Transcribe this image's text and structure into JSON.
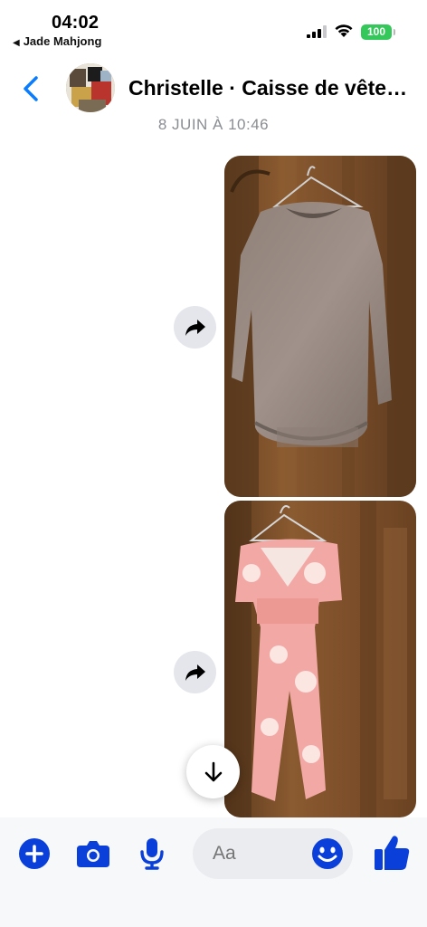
{
  "status_bar": {
    "time": "04:02",
    "back_app": "Jade Mahjong",
    "battery": "100",
    "battery_color": "#34c759"
  },
  "header": {
    "title": "Christelle · Caisse de vêtements",
    "back_icon": "chevron-left-icon",
    "accent_color": "#0a7cff"
  },
  "thread": {
    "date_separator": "8 JUIN À 10:46",
    "messages": [
      {
        "type": "photo",
        "subject": "taupe-sweater-dress",
        "share_icon": "share-arrow-icon"
      },
      {
        "type": "photo",
        "subject": "pink-jumpsuit",
        "share_icon": "share-arrow-icon"
      }
    ],
    "scroll_icon": "arrow-down-icon"
  },
  "composer": {
    "placeholder": "Aa",
    "icons": [
      "plus-icon",
      "camera-icon",
      "mic-icon",
      "emoji-icon",
      "thumbs-up-icon"
    ],
    "icon_color": "#0a3fd9"
  }
}
